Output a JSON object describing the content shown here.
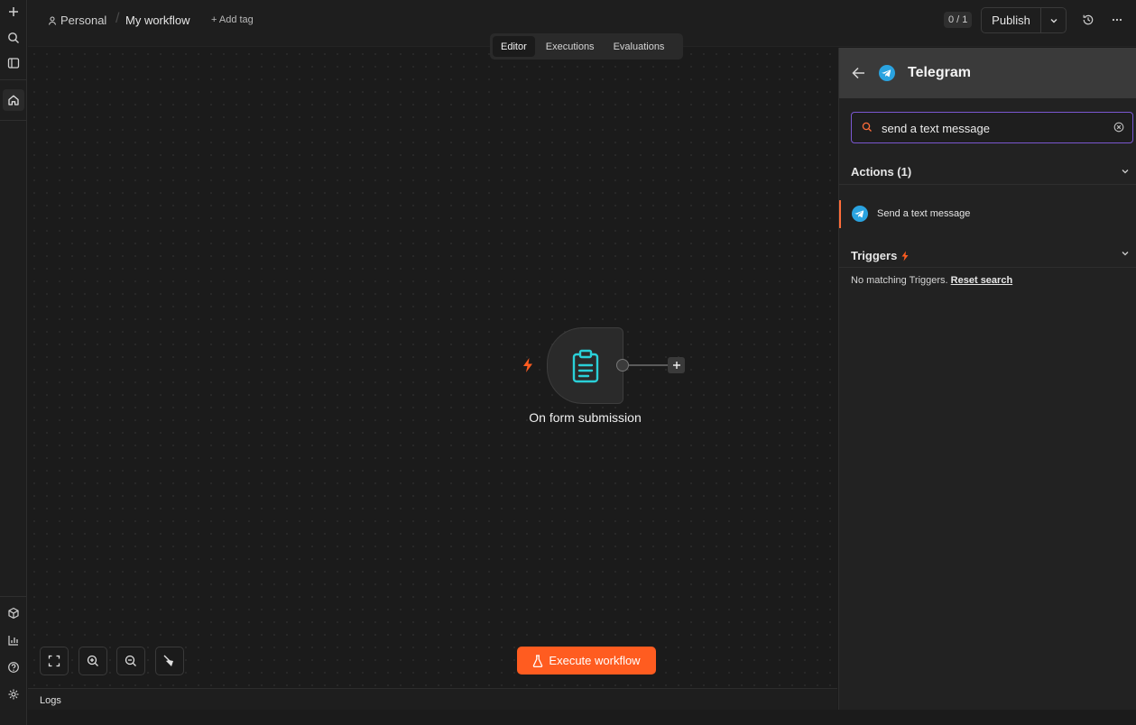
{
  "header": {
    "project": "Personal",
    "workflow_name": "My workflow",
    "add_tag": "+ Add tag",
    "counter": "0 / 1",
    "publish_label": "Publish"
  },
  "tabs": [
    {
      "label": "Editor",
      "active": true
    },
    {
      "label": "Executions",
      "active": false
    },
    {
      "label": "Evaluations",
      "active": false
    }
  ],
  "canvas": {
    "node_label": "On form submission",
    "execute_label": "Execute workflow"
  },
  "logs_label": "Logs",
  "panel": {
    "title": "Telegram",
    "search_value": "send a text message",
    "actions_title": "Actions (1)",
    "action_item": "Send a text message",
    "triggers_title": "Triggers",
    "no_match_text": "No matching Triggers.",
    "reset_label": "Reset search"
  },
  "colors": {
    "accent": "#ff5c20",
    "telegram": "#2aa3e0",
    "node_icon": "#2ad0d8",
    "search_border": "#7a57d1"
  }
}
